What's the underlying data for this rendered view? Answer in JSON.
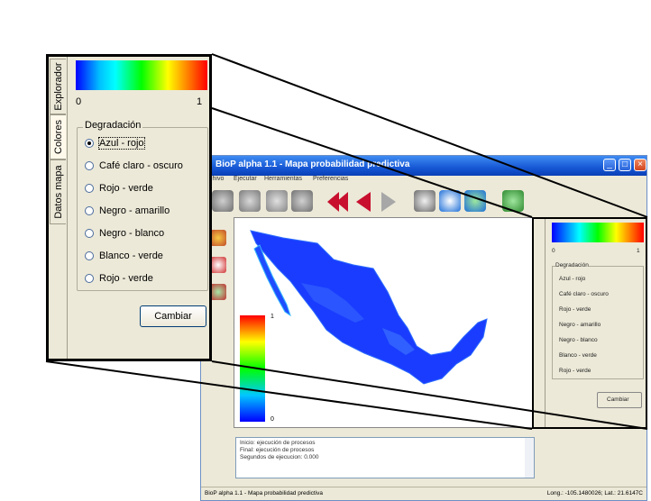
{
  "app": {
    "title": "BioP alpha 1.1 - Mapa probabilidad predictiva",
    "window_buttons": [
      "_",
      "□",
      "×"
    ],
    "menu": [
      "Archivo",
      "Ejecutar",
      "Herramientas",
      "Preferencias"
    ],
    "legend_max": "1",
    "legend_min": "0",
    "log_lines": [
      "Inicio: ejecución de procesos",
      "Final: ejecución de procesos",
      "Segundos de ejecucion: 0.000"
    ],
    "status_left": "BioP alpha 1.1 - Mapa probabilidad predictiva",
    "status_right": "Long.: -105.1480026; Lat.: 21.6147C"
  },
  "panel": {
    "tabs": [
      "Explorador",
      "Colores",
      "Datos mapa"
    ],
    "active_tab": "Colores",
    "gradient_min": "0",
    "gradient_max": "1",
    "group_title": "Degradación",
    "options": [
      "Azul - rojo",
      "Café claro - oscuro",
      "Rojo - verde",
      "Negro - amarillo",
      "Negro - blanco",
      "Blanco - verde",
      "Rojo - verde"
    ],
    "selected_option": "Azul - rojo",
    "apply_button": "Cambiar"
  },
  "colors": {
    "window_bg": "#ece9d8",
    "titlebar": "#1657d4",
    "map_land": "#1a3cff",
    "gradient": [
      "#0000ff",
      "#00ffff",
      "#00ff00",
      "#ffff00",
      "#ff0000"
    ]
  },
  "icons": [
    "open-icon",
    "save-icon",
    "print-icon",
    "export-icon",
    "rewind-icon",
    "back-icon",
    "forward-icon",
    "zoom-icon",
    "globe-icon",
    "layers-icon",
    "network-icon"
  ]
}
